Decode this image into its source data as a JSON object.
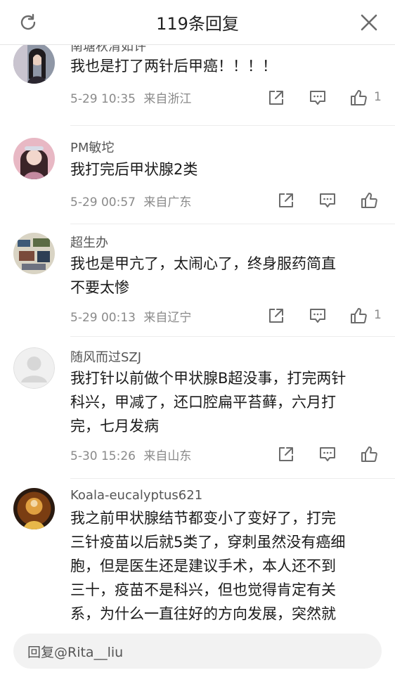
{
  "header": {
    "title": "119条回复"
  },
  "comments": [
    {
      "name": "南塘秋清如许",
      "text": "我也是打了两针后甲癌！！！！",
      "time": "5-29 10:35",
      "location": "来自浙江",
      "likes": "1"
    },
    {
      "name": "PM敏坨",
      "text": "我打完后甲状腺2类",
      "time": "5-29 00:57",
      "location": "来自广东",
      "likes": ""
    },
    {
      "name": "超生办",
      "text_lines": [
        "我也是甲亢了，太闹心了，终身服药简直",
        "不要太惨"
      ],
      "time": "5-29 00:13",
      "location": "来自辽宁",
      "likes": "1"
    },
    {
      "name": "随风而过SZJ",
      "text_lines": [
        "我打针以前做个甲状腺B超没事，打完两针",
        "科兴，甲减了，还口腔扁平苔藓，六月打",
        "完，七月发病"
      ],
      "time": "5-30 15:26",
      "location": "来自山东",
      "likes": ""
    },
    {
      "name": "Koala-eucalyptus621",
      "text_lines": [
        "我之前甲状腺结节都变小了变好了，打完",
        "三针疫苗以后就5类了，穿刺虽然没有癌细",
        "胞，但是医生还是建议手术，本人还不到",
        "三十，疫苗不是科兴，但也觉得肯定有关",
        "系，为什么一直往好的方向发展，突然就"
      ]
    }
  ],
  "reply": {
    "placeholder": "回复@Rita__liu"
  },
  "icons": {
    "refresh": "refresh-icon",
    "close": "close-icon",
    "share": "share-icon",
    "comment": "comment-icon",
    "like": "thumbs-up-icon"
  },
  "colors": {
    "text": "#1a1a1a",
    "meta": "#8a8a8a",
    "icon": "#6b6b6b",
    "reply_bg": "#f2f2f2"
  }
}
